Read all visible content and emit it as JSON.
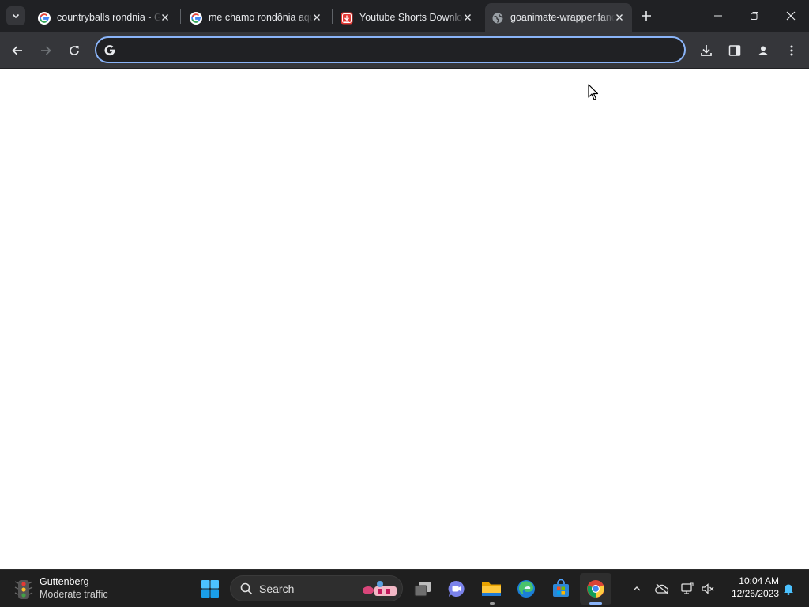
{
  "browser": {
    "tabs": [
      {
        "title": "countryballs rondnia - Google Search",
        "favicon": "google-g-icon"
      },
      {
        "title": "me chamo rondônia aqui - Google Search",
        "favicon": "google-g-icon"
      },
      {
        "title": "Youtube Shorts Downloader",
        "favicon": "download-app-icon"
      },
      {
        "title": "goanimate-wrapper.fandom.com",
        "favicon": "globe-icon",
        "active": true
      }
    ],
    "address_bar": {
      "value": "",
      "placeholder": ""
    },
    "accent_color": "#8ab4f8"
  },
  "taskbar": {
    "weather": {
      "title": "Guttenberg",
      "subtitle": "Moderate traffic",
      "icon": "traffic-light-icon"
    },
    "search": {
      "label": "Search"
    },
    "clock": {
      "time": "10:04 AM",
      "date": "12/26/2023"
    }
  }
}
